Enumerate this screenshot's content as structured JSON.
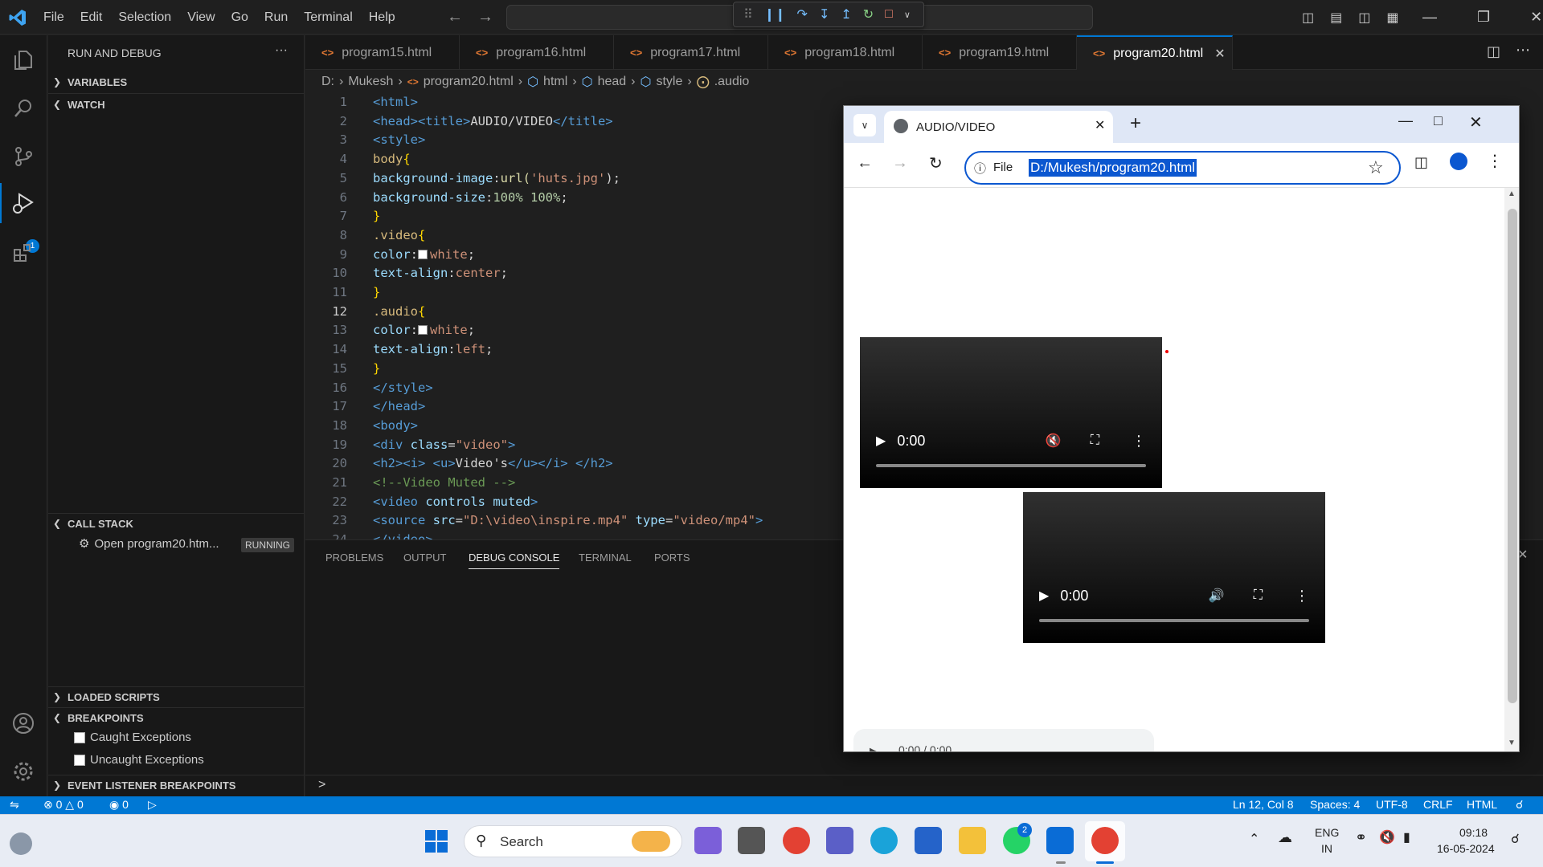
{
  "menu": [
    "File",
    "Edit",
    "Selection",
    "View",
    "Go",
    "Run",
    "Terminal",
    "Help"
  ],
  "sidebar": {
    "title": "RUN AND DEBUG",
    "more": "···",
    "variables": "VARIABLES",
    "watch": "WATCH",
    "call_stack": "CALL STACK",
    "session_label": "Open program20.htm...",
    "session_status": "RUNNING",
    "loaded_scripts": "LOADED SCRIPTS",
    "breakpoints": "BREAKPOINTS",
    "caught": "Caught Exceptions",
    "uncaught": "Uncaught Exceptions",
    "event_bp": "EVENT LISTENER BREAKPOINTS",
    "badge": "1"
  },
  "tabs": [
    "program15.html",
    "program16.html",
    "program17.html",
    "program18.html",
    "program19.html",
    "program20.html"
  ],
  "active_tab": "program20.html",
  "breadcrumb": [
    "D:",
    "Mukesh",
    "program20.html",
    "html",
    "head",
    "style",
    ".audio"
  ],
  "line_numbers": [
    "1",
    "2",
    "3",
    "4",
    "5",
    "6",
    "7",
    "8",
    "9",
    "10",
    "11",
    "12",
    "13",
    "14",
    "15",
    "16",
    "17",
    "18",
    "19",
    "20",
    "21",
    "22",
    "23",
    "24"
  ],
  "code": {
    "l1": "<html>",
    "l2a": "<head><title>",
    "l2b": "AUDIO/VIDEO",
    "l2c": "</title>",
    "l3": "<style>",
    "l4a": "body",
    "l4b": "{",
    "l5a": "background-image",
    "l5b": ":",
    "l5c": "url(",
    "l5d": "'huts.jpg'",
    "l5e": ");",
    "l6a": "background-size",
    "l6b": ":",
    "l6c": "100% 100%",
    ";": ";",
    "l7": "}",
    "l8a": ".video",
    "l8b": "{",
    "l9a": "color",
    "l9b": ":",
    "l9c": "white",
    "l10a": "text-align",
    "l10b": ":",
    "l10c": "center",
    "l11": "}",
    "l12a": ".audio",
    "l12b": "{",
    "l13a": "color",
    "l13b": ":",
    "l13c": "white",
    "l14a": "text-align",
    "l14b": ":",
    "l14c": "left",
    "l15": "}",
    "l16": "</style>",
    "l17": "</head>",
    "l18": "<body>",
    "l19a": "<div ",
    "l19b": "class",
    "l19c": "=",
    "l19d": "\"video\"",
    "l19e": ">",
    "l20a": "<h2><i> <u>",
    "l20b": "Video's",
    "l20c": "</u></i> </h2>",
    "l21": "<!--Video Muted -->",
    "l22a": "<video ",
    "l22b": "controls muted",
    "l22c": ">",
    "l23a": "<source ",
    "l23b": "src",
    "l23c": "=",
    "l23d": "\"D:\\video\\inspire.mp4\"",
    "l23e": " type",
    "l23f": "=",
    "l23g": "\"video/mp4\"",
    "l23h": ">",
    "l24": "</video>"
  },
  "panel_tabs": [
    "PROBLEMS",
    "OUTPUT",
    "DEBUG CONSOLE",
    "TERMINAL",
    "PORTS"
  ],
  "panel_prompt": ">",
  "status": {
    "errors": "0",
    "warnings": "0",
    "ports": "0",
    "position": "Ln 12, Col 8",
    "spaces": "Spaces: 4",
    "encoding": "UTF-8",
    "eol": "CRLF",
    "lang": "HTML"
  },
  "browser": {
    "tab_title": "AUDIO/VIDEO",
    "file_label": "File",
    "url": "D:/Mukesh/program20.html",
    "video1_time": "0:00",
    "video2_time": "0:00",
    "audio_time": "0:00 / 0:00"
  },
  "taskbar": {
    "search": "Search",
    "lang1": "ENG",
    "lang2": "IN",
    "time": "09:18",
    "date": "16-05-2024",
    "whatsapp_badge": "2"
  }
}
